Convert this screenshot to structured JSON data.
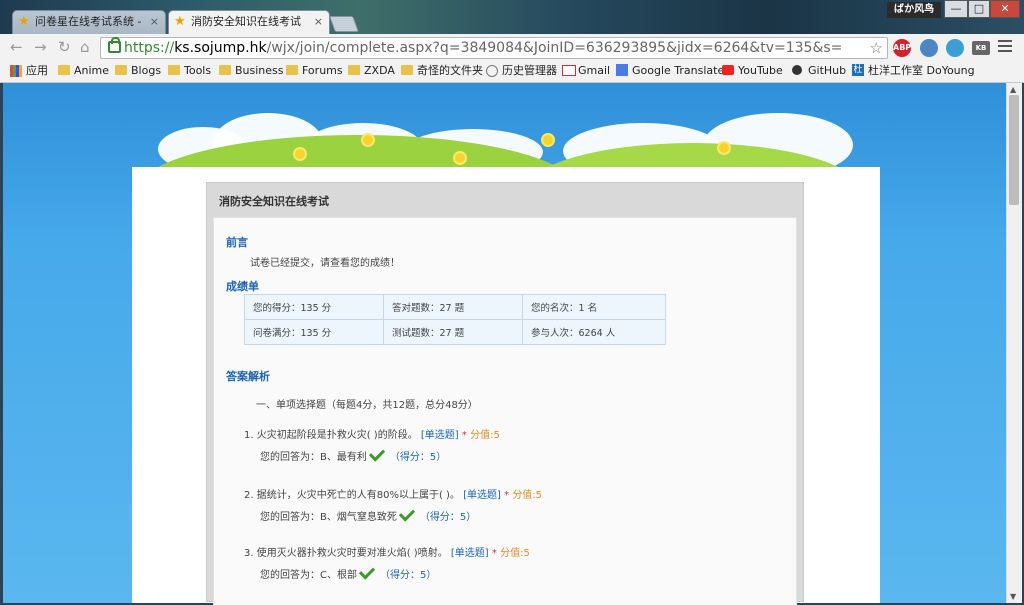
{
  "browser": {
    "tabs": [
      {
        "title": "问卷星在线考试系统 - 免费",
        "close": "×"
      },
      {
        "title": "消防安全知识在线考试--问卷",
        "close": "×"
      }
    ],
    "username": "ばか风鸟",
    "window_buttons": {
      "minimize": "—",
      "maximize": "□",
      "close": "✕"
    },
    "nav": {
      "back": "←",
      "forward": "→",
      "reload": "↻",
      "home": "⌂"
    },
    "url": {
      "scheme": "https://",
      "host": "ks.sojump.hk",
      "path": "/wjx/join/complete.aspx?q=3849084&JoinID=636293895&jidx=6264&tv=135&s="
    },
    "bookmark_star": "☆",
    "extensions": [
      "ABP",
      "",
      "",
      "KB"
    ],
    "bookmarks": [
      "应用",
      "Anime",
      "Blogs",
      "Tools",
      "Business",
      "Forums",
      "ZXDA",
      "奇怪的文件夹",
      "历史管理器",
      "Gmail",
      "Google Translate",
      "YouTube",
      "GitHub",
      "杜洋工作室 DoYoung"
    ]
  },
  "page": {
    "exam_title": "消防安全知识在线考试",
    "preface_heading": "前言",
    "preface_text": "试卷已经提交，请查看您的成绩！",
    "report_heading": "成绩单",
    "score_table": [
      [
        "您的得分：135 分",
        "答对题数：27 题",
        "您的名次：1 名"
      ],
      [
        "问卷满分：135 分",
        "测试题数：27 题",
        "参与人次：6264 人"
      ]
    ],
    "analysis_heading": "答案解析",
    "part_title": "一、单项选择题（每题4分，共12题，总分48分）",
    "questions": [
      {
        "text": "1.  火灾初起阶段是扑救火灾(   )的阶段。",
        "type": "[单选题]",
        "star": "*",
        "points": "分值:5",
        "answer": "您的回答为：B、最有利",
        "score": "（得分：5）"
      },
      {
        "text": "2.  据统计，火灾中死亡的人有80%以上属于(   )。",
        "type": "[单选题]",
        "star": "*",
        "points": "分值:5",
        "answer": "您的回答为：B、烟气窒息致死",
        "score": "（得分：5）"
      },
      {
        "text": "3.  使用灭火器扑救火灾时要对准火焰(   )喷射。",
        "type": "[单选题]",
        "star": "*",
        "points": "分值:5",
        "answer": "您的回答为：C、根部",
        "score": "（得分：5）"
      }
    ]
  },
  "scrollbar": {
    "up": "▲",
    "down": "▼"
  }
}
